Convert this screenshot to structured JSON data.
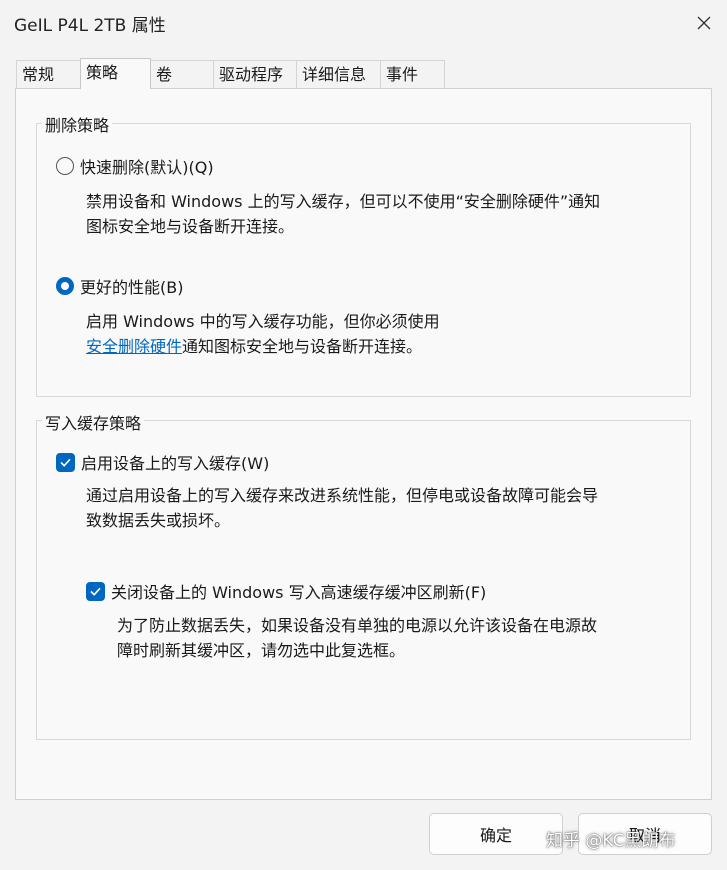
{
  "window": {
    "title": "GeIL P4L 2TB 属性"
  },
  "tabs": [
    {
      "label": "常规",
      "active": false
    },
    {
      "label": "策略",
      "active": true
    },
    {
      "label": "卷",
      "active": false
    },
    {
      "label": "驱动程序",
      "active": false
    },
    {
      "label": "详细信息",
      "active": false
    },
    {
      "label": "事件",
      "active": false
    }
  ],
  "removal_policy": {
    "title": "删除策略",
    "quick_removal": {
      "label": "快速删除(默认)(Q)",
      "checked": false,
      "desc_line1": "禁用设备和 Windows 上的写入缓存，但可以不使用“安全删除硬件”通知",
      "desc_line2": "图标安全地与设备断开连接。"
    },
    "better_performance": {
      "label": "更好的性能(B)",
      "checked": true,
      "desc_line1": "启用 Windows 中的写入缓存功能，但你必须使用",
      "link": "安全删除硬件",
      "desc_line2_rest": "通知图标安全地与设备断开连接。"
    }
  },
  "write_cache_policy": {
    "title": "写入缓存策略",
    "enable_cache": {
      "label": "启用设备上的写入缓存(W)",
      "checked": true,
      "desc_line1": "通过启用设备上的写入缓存来改进系统性能，但停电或设备故障可能会导",
      "desc_line2": "致数据丢失或损坏。"
    },
    "turn_off_flush": {
      "label": "关闭设备上的 Windows 写入高速缓存缓冲区刷新(F)",
      "checked": true,
      "desc_line1": "为了防止数据丢失，如果设备没有单独的电源以允许该设备在电源故",
      "desc_line2": "障时刷新其缓冲区，请勿选中此复选框。"
    }
  },
  "buttons": {
    "ok": "确定",
    "cancel": "取消"
  },
  "watermark": "知乎 @KC黑朗布",
  "colors": {
    "accent": "#0067c0",
    "background": "#f3f3f3",
    "panel": "#f9f9f9"
  }
}
